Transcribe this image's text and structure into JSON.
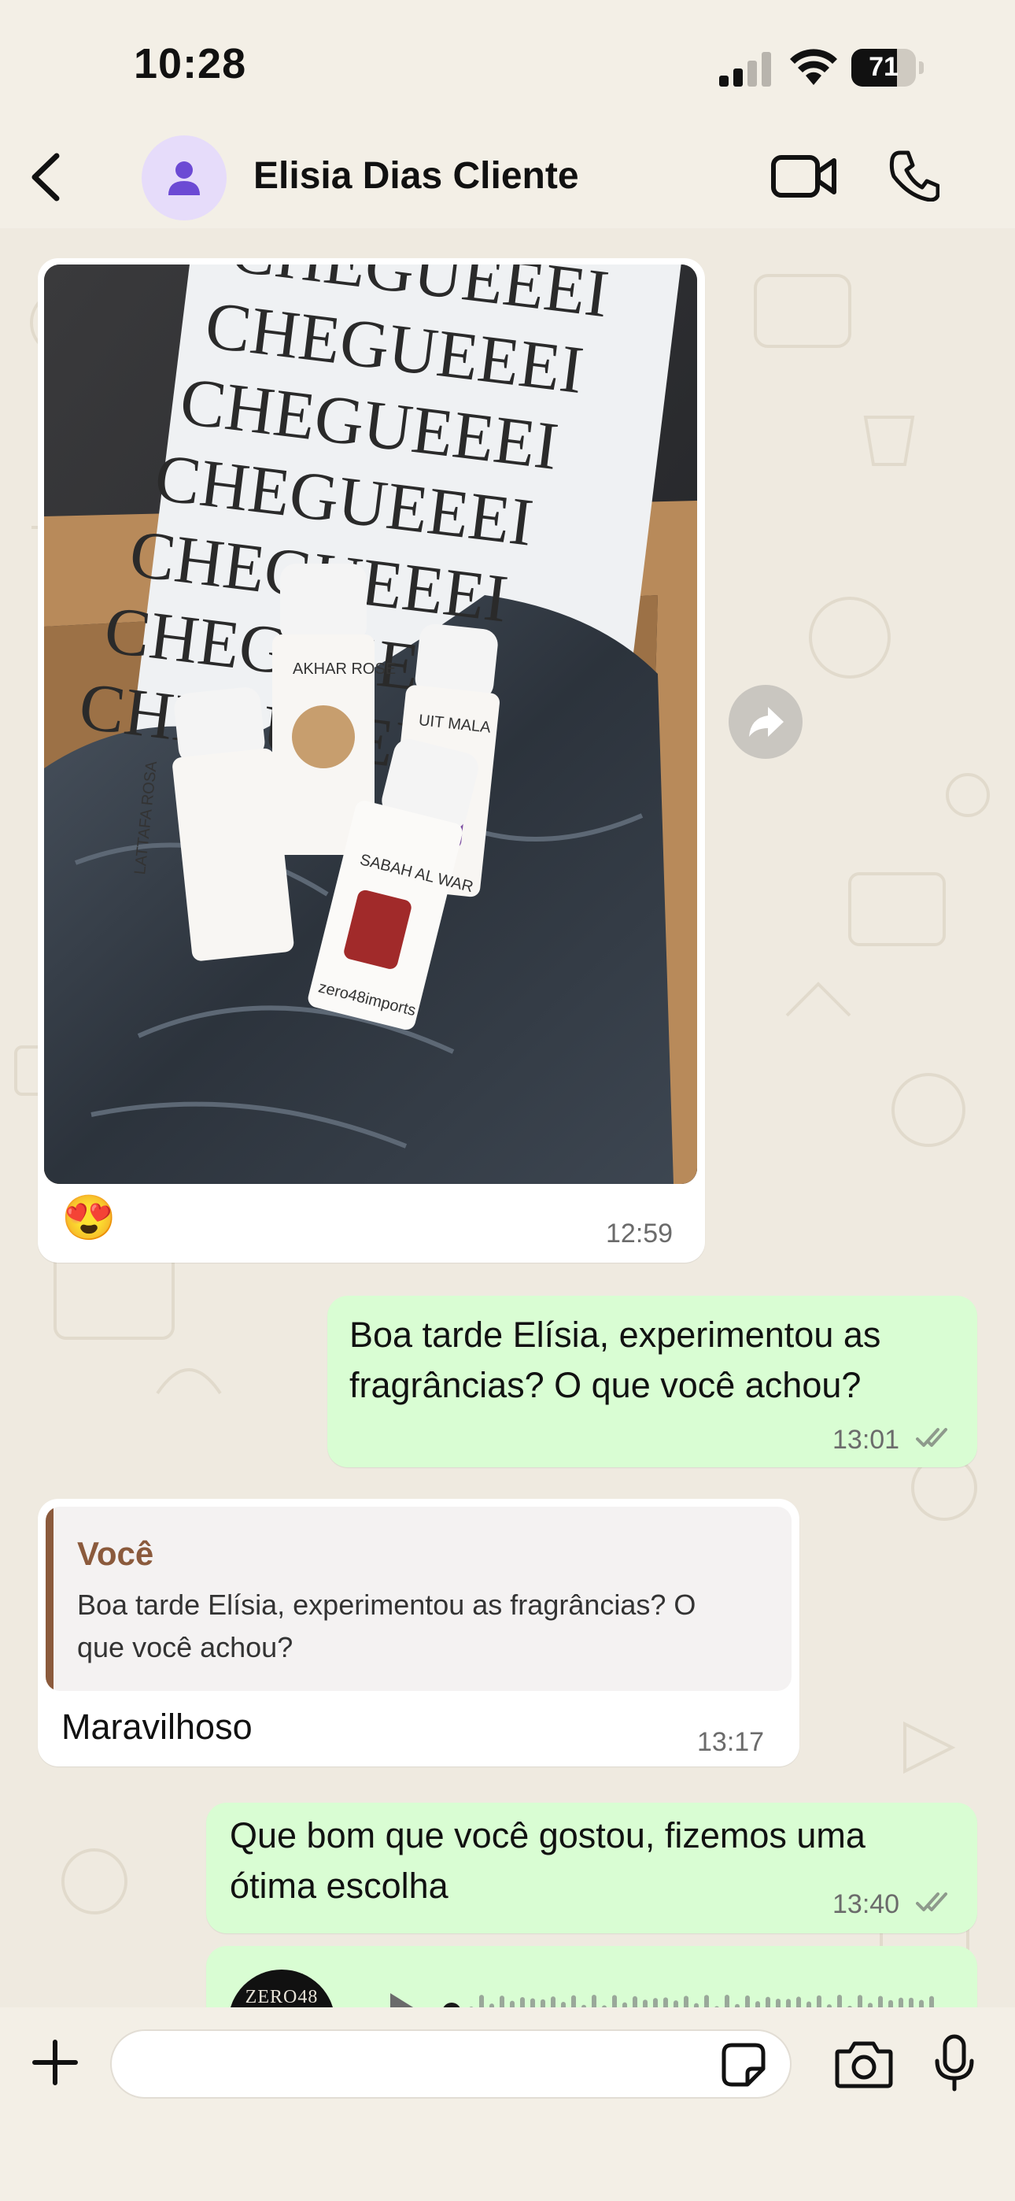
{
  "status_bar": {
    "time": "10:28",
    "battery": "71",
    "battery_level": 0.71
  },
  "header": {
    "back_icon": "chevron-left-icon",
    "contact_name": "Elisia Dias Cliente",
    "video_icon": "video-camera-icon",
    "call_icon": "phone-icon"
  },
  "messages": [
    {
      "type": "image",
      "direction": "incoming",
      "photo_text": {
        "repeated_line": "CHEGUEEEI",
        "bottle_labels": [
          "LATTAFA ROSA",
          "AKHAR ROSE",
          "UIT MALA",
          "SABAH AL WAR"
        ],
        "brand": "zero48imports"
      },
      "reaction": "😍",
      "time": "12:59"
    },
    {
      "type": "text",
      "direction": "outgoing",
      "text_lines": [
        "Boa tarde Elísia, experimentou as",
        "fragrâncias? O que você achou?"
      ],
      "time": "13:01",
      "status": "read"
    },
    {
      "type": "reply",
      "direction": "incoming",
      "quote_author": "Você",
      "quote_lines": [
        "Boa tarde Elísia, experimentou as fragrâncias? O",
        "que você achou?"
      ],
      "text": "Maravilhoso",
      "time": "13:17"
    },
    {
      "type": "text",
      "direction": "outgoing",
      "text_lines": [
        "Que bom que você gostou, fizemos uma",
        "ótima escolha"
      ],
      "time": "13:40",
      "status": "read"
    },
    {
      "type": "audio",
      "direction": "outgoing",
      "avatar_text": "ZERO48"
    }
  ],
  "colors": {
    "outgoing_bubble": "#d9fdd3",
    "incoming_bubble": "#ffffff",
    "quote_accent": "#8b5a3c",
    "read_ticks": "#8e9a8c"
  },
  "input_bar": {
    "plus_icon": "plus-icon",
    "sticker_icon": "sticker-icon",
    "camera_icon": "camera-icon",
    "mic_icon": "microphone-icon"
  }
}
